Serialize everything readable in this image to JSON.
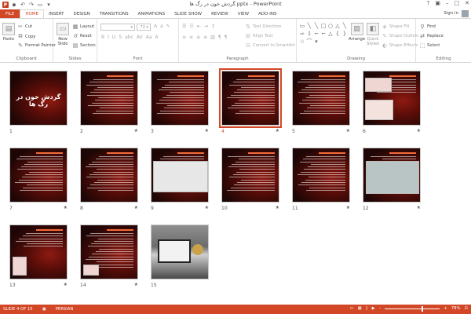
{
  "window": {
    "title": "گردش خون در رگ ها.pptx - PowerPoint",
    "qat_icons": [
      "powerpoint-logo",
      "save-icon",
      "undo-icon",
      "redo-icon",
      "start-slideshow-icon",
      "customize-qat-icon"
    ],
    "controls": {
      "help": "?",
      "restore": "▣",
      "minimize": "–",
      "maximize": "□",
      "close": "✕"
    }
  },
  "ribbon_tabs": [
    "FILE",
    "HOME",
    "INSERT",
    "DESIGN",
    "TRANSITIONS",
    "ANIMATIONS",
    "SLIDE SHOW",
    "REVIEW",
    "VIEW",
    "ADD-INS"
  ],
  "active_tab": "HOME",
  "sign_in": "Sign in",
  "ribbon": {
    "clipboard": {
      "label": "Clipboard",
      "paste": "Paste",
      "cut": "Cut",
      "copy": "Copy",
      "format_painter": "Format Painter"
    },
    "slides": {
      "label": "Slides",
      "new_slide": "New Slide",
      "layout": "Layout",
      "reset": "Reset",
      "section": "Section"
    },
    "font": {
      "label": "Font",
      "size": "72"
    },
    "paragraph": {
      "label": "Paragraph",
      "text_direction": "Text Direction",
      "align_text": "Align Text",
      "convert_smartart": "Convert to SmartArt"
    },
    "drawing": {
      "label": "Drawing",
      "arrange": "Arrange",
      "quick_styles": "Quick Styles",
      "shape_fill": "Shape Fill",
      "shape_outline": "Shape Outline",
      "shape_effects": "Shape Effects"
    },
    "editing": {
      "label": "Editing",
      "find": "Find",
      "replace": "Replace",
      "select": "Select"
    }
  },
  "slides": [
    {
      "num": "1",
      "star": false,
      "kind": "title",
      "title": "گردش خون در رگ ها"
    },
    {
      "num": "2",
      "star": true,
      "kind": "text"
    },
    {
      "num": "3",
      "star": true,
      "kind": "text"
    },
    {
      "num": "4",
      "star": true,
      "kind": "text",
      "selected": true
    },
    {
      "num": "5",
      "star": true,
      "kind": "text"
    },
    {
      "num": "6",
      "star": true,
      "kind": "image"
    },
    {
      "num": "7",
      "star": true,
      "kind": "text"
    },
    {
      "num": "8",
      "star": true,
      "kind": "text"
    },
    {
      "num": "9",
      "star": true,
      "kind": "panel"
    },
    {
      "num": "10",
      "star": true,
      "kind": "text"
    },
    {
      "num": "11",
      "star": true,
      "kind": "text"
    },
    {
      "num": "12",
      "star": true,
      "kind": "panel2"
    },
    {
      "num": "13",
      "star": true,
      "kind": "image2"
    },
    {
      "num": "14",
      "star": true,
      "kind": "text2"
    },
    {
      "num": "15",
      "star": false,
      "kind": "photo"
    }
  ],
  "status": {
    "slide": "SLIDE 4 OF 15",
    "language": "PERSIAN",
    "zoom": "78%",
    "zoom_level": 0.78
  }
}
